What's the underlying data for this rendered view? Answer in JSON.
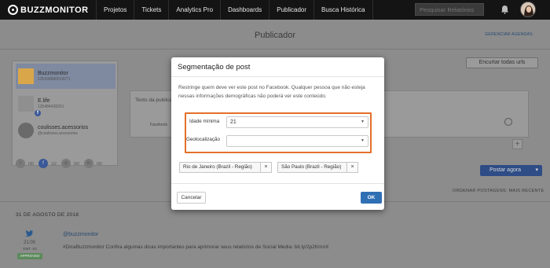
{
  "nav": {
    "brand": "BUZZMONITOR",
    "items": [
      "Projetos",
      "Tickets",
      "Analytics Pro",
      "Dashboards",
      "Publicador",
      "Busca Histórica"
    ],
    "search_placeholder": "Pesquisar Relatórios"
  },
  "page": {
    "title": "Publicador",
    "manage_agendas": "GERENCIAR AGENDAS",
    "shorten_urls": "Encurtar todas urls",
    "compose_placeholder": "Texto da publicação",
    "compose_footer": "Facebook",
    "post_now": "Postar agora",
    "order_by": "ORDENAR POSTAGENS: MAIS RECENTE",
    "date_heading": "31 DE AGOSTO DE 2018",
    "post": {
      "time": "21:00",
      "tz": "GMT -03",
      "status": "APPROVED",
      "handle": "@buzzmonitor",
      "text": "#DicaBuzzmonitor Confira algumas dicas importantes para aprimorar seus relatórios de Social Media: bit.ly/2p2KmnX"
    }
  },
  "accounts": [
    {
      "name": "Buzzmonitor",
      "id": "135438880018271",
      "selected": true
    },
    {
      "name": "E.life",
      "id": "125484428201",
      "selected": false
    },
    {
      "name": "coulisses.acessorios",
      "id": "@coulisses.acessorios",
      "selected": false
    }
  ],
  "social_counts": [
    "0/0",
    "1/2",
    "0/0",
    "0/0"
  ],
  "modal": {
    "title": "Segmentação de post",
    "description": "Restringe quem deve ver este post no Facebook. Qualquer pessoa que não esteja nessas informações demográficas não poderá ver este conteúdo.",
    "min_age_label": "Idade mínima",
    "min_age_value": "21",
    "geo_label": "Geolocalização",
    "geo_value": "",
    "locations": [
      "Rio de Janeiro (Brazil - Região)",
      "São Paulo (Brazil - Região)"
    ],
    "cancel": "Cancelar",
    "ok": "OK",
    "highlight_color": "#e3702a"
  }
}
